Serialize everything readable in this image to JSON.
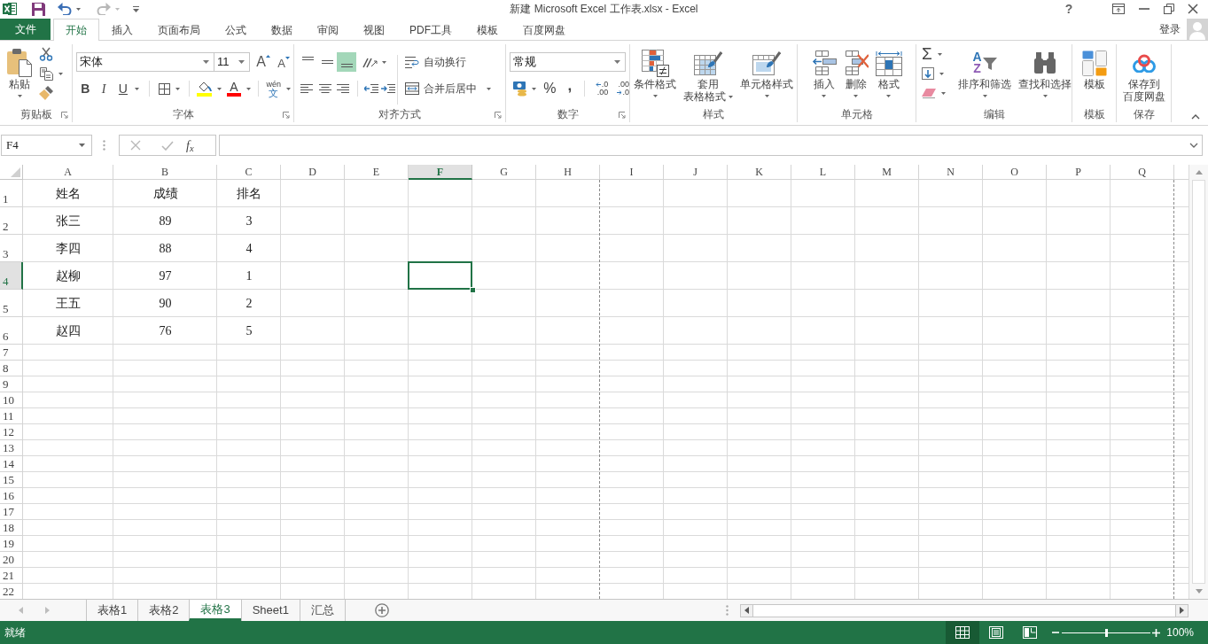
{
  "window": {
    "title": "新建 Microsoft Excel 工作表.xlsx - Excel",
    "help": "?"
  },
  "ribbon_tabs": [
    {
      "label": "文件",
      "kind": "file",
      "selected": false
    },
    {
      "label": "开始",
      "kind": "tab",
      "selected": true
    },
    {
      "label": "插入",
      "kind": "tab",
      "selected": false
    },
    {
      "label": "页面布局",
      "kind": "tab",
      "selected": false
    },
    {
      "label": "公式",
      "kind": "tab",
      "selected": false
    },
    {
      "label": "数据",
      "kind": "tab",
      "selected": false
    },
    {
      "label": "审阅",
      "kind": "tab",
      "selected": false
    },
    {
      "label": "视图",
      "kind": "tab",
      "selected": false
    },
    {
      "label": "PDF工具",
      "kind": "tab",
      "selected": false
    },
    {
      "label": "模板",
      "kind": "tab",
      "selected": false
    },
    {
      "label": "百度网盘",
      "kind": "tab",
      "selected": false
    }
  ],
  "account": {
    "label": "登录"
  },
  "ribbon": {
    "groups": [
      {
        "kind": "clipboard",
        "label": "剪贴板",
        "launcher": true,
        "paste": "粘贴"
      },
      {
        "kind": "font",
        "label": "字体",
        "launcher": true,
        "font_name": "宋体",
        "font_size": "11",
        "grow": "A",
        "shrink": "A",
        "bold": "B",
        "italic": "I",
        "underline": "U",
        "font_color": "A",
        "phonetic": [
          "wén",
          "文"
        ]
      },
      {
        "kind": "alignment",
        "label": "对齐方式",
        "launcher": true,
        "vertical": [
          {
            "kind": "top",
            "selected": false
          },
          {
            "kind": "middle",
            "selected": false
          },
          {
            "kind": "bottom",
            "selected": true
          }
        ],
        "wrap_text": "自动换行",
        "merge": "合并后居中"
      },
      {
        "kind": "number",
        "label": "数字",
        "launcher": true,
        "format": "常规",
        "percent": "%",
        "comma": ",",
        "increase_decimal": [
          ".0",
          ".00"
        ],
        "decrease_decimal": [
          ".00",
          ".0"
        ]
      },
      {
        "kind": "buttons",
        "label": "样式",
        "buttons": [
          {
            "kind": "conditional",
            "lines": [
              "条件格式"
            ],
            "dropdown": true
          },
          {
            "kind": "tablestyle",
            "lines": [
              "套用",
              "表格格式"
            ],
            "dropdown": true
          },
          {
            "kind": "cellstyle",
            "lines": [
              "单元格样式"
            ],
            "dropdown": true
          }
        ]
      },
      {
        "kind": "buttons",
        "label": "单元格",
        "buttons": [
          {
            "kind": "insert",
            "lines": [
              "插入"
            ],
            "dropdown": true
          },
          {
            "kind": "delete",
            "lines": [
              "删除"
            ],
            "dropdown": true
          },
          {
            "kind": "format",
            "lines": [
              "格式"
            ],
            "dropdown": true
          }
        ]
      },
      {
        "kind": "editing",
        "label": "编辑",
        "autosum": "Σ",
        "buttons": [
          {
            "kind": "sort",
            "glyphs": [
              "A",
              "Z"
            ],
            "lines": [
              "排序和筛选"
            ],
            "dropdown": true
          },
          {
            "kind": "find",
            "lines": [
              "查找和选择"
            ],
            "dropdown": true
          }
        ]
      },
      {
        "kind": "buttons",
        "label": "模板",
        "buttons": [
          {
            "kind": "template",
            "lines": [
              "模板"
            ],
            "dropdown": false
          }
        ]
      },
      {
        "kind": "buttons",
        "label": "保存",
        "buttons": [
          {
            "kind": "cloud",
            "lines": [
              "保存到",
              "百度网盘"
            ],
            "dropdown": false
          }
        ]
      }
    ]
  },
  "formula_bar": {
    "name_box": "F4",
    "function": "f$_{x}$"
  },
  "sheet": {
    "columns": [
      {
        "label": "A",
        "selected": false
      },
      {
        "label": "B",
        "selected": false
      },
      {
        "label": "C",
        "selected": false
      },
      {
        "label": "D",
        "selected": false
      },
      {
        "label": "E",
        "selected": false
      },
      {
        "label": "F",
        "selected": true
      },
      {
        "label": "G",
        "selected": false
      },
      {
        "label": "H",
        "selected": false
      },
      {
        "label": "I",
        "selected": false
      },
      {
        "label": "J",
        "selected": false
      },
      {
        "label": "K",
        "selected": false
      },
      {
        "label": "L",
        "selected": false
      },
      {
        "label": "M",
        "selected": false
      },
      {
        "label": "N",
        "selected": false
      },
      {
        "label": "O",
        "selected": false
      },
      {
        "label": "P",
        "selected": false
      },
      {
        "label": "Q",
        "selected": false
      }
    ],
    "rows": [
      {
        "label": "1",
        "selected": false,
        "cells": [
          "姓名",
          "成绩",
          "排名"
        ]
      },
      {
        "label": "2",
        "selected": false,
        "cells": [
          "张三",
          "89",
          "3"
        ]
      },
      {
        "label": "3",
        "selected": false,
        "cells": [
          "李四",
          "88",
          "4"
        ]
      },
      {
        "label": "4",
        "selected": true,
        "cells": [
          "赵柳",
          "97",
          "1"
        ]
      },
      {
        "label": "5",
        "selected": false,
        "cells": [
          "王五",
          "90",
          "2"
        ]
      },
      {
        "label": "6",
        "selected": false,
        "cells": [
          "赵四",
          "76",
          "5"
        ]
      },
      {
        "label": "7",
        "selected": false
      },
      {
        "label": "8",
        "selected": false
      },
      {
        "label": "9",
        "selected": false
      },
      {
        "label": "10",
        "selected": false
      },
      {
        "label": "11",
        "selected": false
      },
      {
        "label": "12",
        "selected": false
      },
      {
        "label": "13",
        "selected": false
      },
      {
        "label": "14",
        "selected": false
      },
      {
        "label": "15",
        "selected": false
      },
      {
        "label": "16",
        "selected": false
      },
      {
        "label": "17",
        "selected": false
      },
      {
        "label": "18",
        "selected": false
      },
      {
        "label": "19",
        "selected": false
      },
      {
        "label": "20",
        "selected": false
      },
      {
        "label": "21",
        "selected": false
      },
      {
        "label": "22",
        "selected": false
      }
    ]
  },
  "sheet_tabs": [
    {
      "label": "表格1",
      "selected": false
    },
    {
      "label": "表格2",
      "selected": false
    },
    {
      "label": "表格3",
      "selected": true
    },
    {
      "label": "Sheet1",
      "selected": false
    },
    {
      "label": "汇总",
      "selected": false
    }
  ],
  "status_bar": {
    "status": "就绪",
    "views": [
      {
        "kind": "normal",
        "selected": true
      },
      {
        "kind": "layout",
        "selected": false
      },
      {
        "kind": "pagebreak",
        "selected": false
      }
    ],
    "zoom": {
      "level": 0.5,
      "reading": "100%"
    }
  }
}
